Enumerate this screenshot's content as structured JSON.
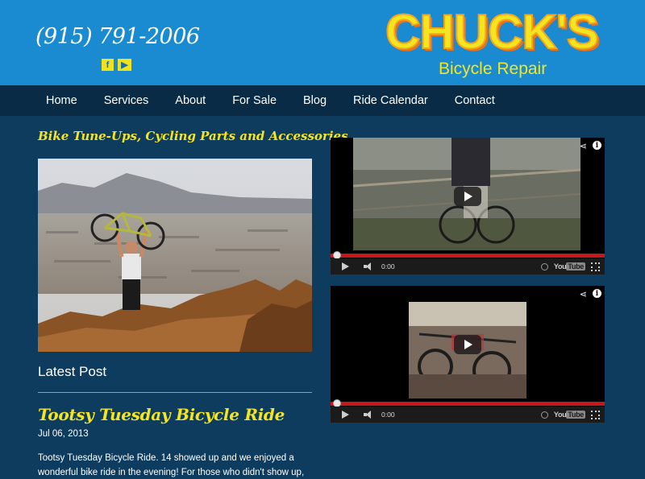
{
  "header": {
    "phone": "(915) 791-2006",
    "social": [
      {
        "icon": "facebook-icon",
        "glyph": "f"
      },
      {
        "icon": "youtube-icon",
        "glyph": "▶"
      }
    ],
    "logo_title": "CHUCK'S",
    "logo_subtitle": "Bicycle Repair"
  },
  "nav": {
    "items": [
      "Home",
      "Services",
      "About",
      "For Sale",
      "Blog",
      "Ride Calendar",
      "Contact"
    ]
  },
  "main": {
    "tagline": "Bike Tune-Ups, Cycling Parts and Accessories",
    "latest_heading": "Latest Post",
    "post": {
      "title": "Tootsy Tuesday Bicycle Ride",
      "date": "Jul 06, 2013",
      "excerpt": "Tootsy Tuesday Bicycle Ride. 14 showed up and we enjoyed a wonderful bike ride in the evening! For those who didn't show up,"
    }
  },
  "videos": [
    {
      "time": "0:00",
      "brand": "You",
      "brand_box": "Tube"
    },
    {
      "time": "0:00",
      "brand": "You",
      "brand_box": "Tube"
    }
  ],
  "colors": {
    "header_bg": "#1a8bd0",
    "nav_bg": "#0a2b45",
    "page_bg": "#0e3c5f",
    "accent_yellow": "#f5e521",
    "progress_red": "#c8171b"
  }
}
